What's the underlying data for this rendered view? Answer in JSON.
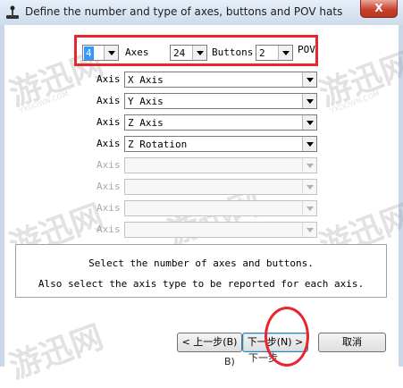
{
  "window": {
    "title": "Define the number and type of axes, buttons and POV hats",
    "close_label": "X"
  },
  "counts": {
    "axes_value": "4",
    "axes_label": "Axes",
    "buttons_value": "24",
    "buttons_label": "Buttons",
    "pov_value": "2",
    "pov_label": "POV"
  },
  "axes": [
    {
      "label": "Axis",
      "value": "X Axis",
      "enabled": true
    },
    {
      "label": "Axis",
      "value": "Y Axis",
      "enabled": true
    },
    {
      "label": "Axis",
      "value": "Z Axis",
      "enabled": true
    },
    {
      "label": "Axis",
      "value": "Z Rotation",
      "enabled": true
    },
    {
      "label": "Axis",
      "value": "",
      "enabled": false
    },
    {
      "label": "Axis",
      "value": "",
      "enabled": false
    },
    {
      "label": "Axis",
      "value": "",
      "enabled": false
    },
    {
      "label": "Axis",
      "value": "",
      "enabled": false
    }
  ],
  "info": {
    "line1": "Select the number of axes and buttons.",
    "line2": "Also select the axis type to be reported for each axis."
  },
  "buttons": {
    "back": "< 上一步(B)",
    "next": "下一步(N) >",
    "cancel": "取消"
  },
  "ghost": {
    "b_label": "B)",
    "next_label": "下一步"
  },
  "watermark": {
    "text": "游迅网",
    "url": "YXDOWN.COM"
  },
  "colors": {
    "annotation_red": "#e8262e",
    "selection_blue": "#3399ff"
  }
}
